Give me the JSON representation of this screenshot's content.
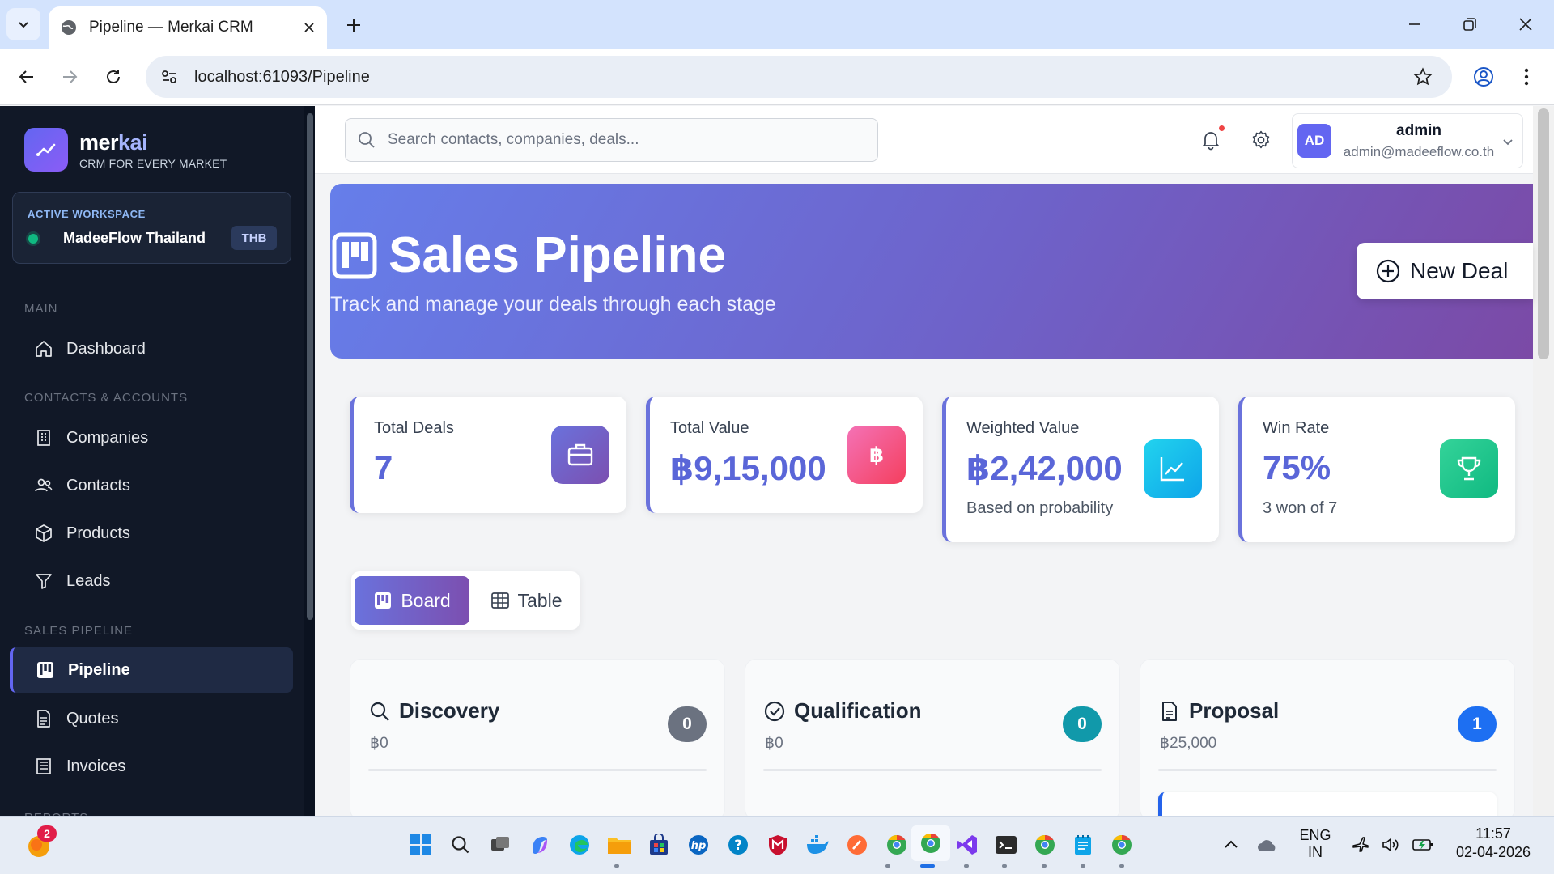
{
  "browser": {
    "tab_title": "Pipeline — Merkai CRM",
    "url": "localhost:61093/Pipeline"
  },
  "brand": {
    "name_part1": "mer",
    "name_part2": "kai",
    "tagline": "CRM FOR EVERY MARKET"
  },
  "workspace": {
    "label": "ACTIVE WORKSPACE",
    "name": "MadeeFlow Thailand",
    "currency": "THB"
  },
  "sidebar": {
    "section_main": "MAIN",
    "section_contacts": "CONTACTS & ACCOUNTS",
    "section_pipeline": "SALES PIPELINE",
    "section_reports": "REPORTS",
    "items": [
      {
        "label": "Dashboard",
        "icon": "home-icon"
      },
      {
        "label": "Companies",
        "icon": "building-icon"
      },
      {
        "label": "Contacts",
        "icon": "people-icon"
      },
      {
        "label": "Products",
        "icon": "box-icon"
      },
      {
        "label": "Leads",
        "icon": "funnel-icon"
      },
      {
        "label": "Pipeline",
        "icon": "kanban-icon",
        "active": true
      },
      {
        "label": "Quotes",
        "icon": "document-icon"
      },
      {
        "label": "Invoices",
        "icon": "receipt-icon"
      }
    ]
  },
  "header": {
    "search_placeholder": "Search contacts, companies, deals...",
    "user_initials": "AD",
    "user_name": "admin",
    "user_email": "admin@madeeflow.co.th"
  },
  "hero": {
    "title": "Sales Pipeline",
    "subtitle": "Track and manage your deals through each stage",
    "new_deal_label": "New Deal"
  },
  "stats": [
    {
      "label": "Total Deals",
      "value": "7",
      "footnote": ""
    },
    {
      "label": "Total Value",
      "value": "฿9,15,000",
      "footnote": ""
    },
    {
      "label": "Weighted Value",
      "value": "฿2,42,000",
      "footnote": "Based on probability"
    },
    {
      "label": "Win Rate",
      "value": "75%",
      "footnote": "3 won of 7"
    }
  ],
  "view_toggle": {
    "board_label": "Board",
    "table_label": "Table",
    "selected": "Board"
  },
  "columns": [
    {
      "title": "Discovery",
      "total": "฿0",
      "count": "0",
      "badge_color": "#6b7280"
    },
    {
      "title": "Qualification",
      "total": "฿0",
      "count": "0",
      "badge_color": "#1199aa"
    },
    {
      "title": "Proposal",
      "total": "฿25,000",
      "count": "1",
      "badge_color": "#1d6ff2"
    }
  ],
  "taskbar": {
    "notification_count": "2",
    "lang_line1": "ENG",
    "lang_line2": "IN",
    "time": "11:57",
    "date": "02-04-2026"
  },
  "colors": {
    "accent": "#6366f1",
    "hero_start": "#667eea",
    "hero_end": "#7b4aa6",
    "sidebar_bg": "#111827"
  }
}
